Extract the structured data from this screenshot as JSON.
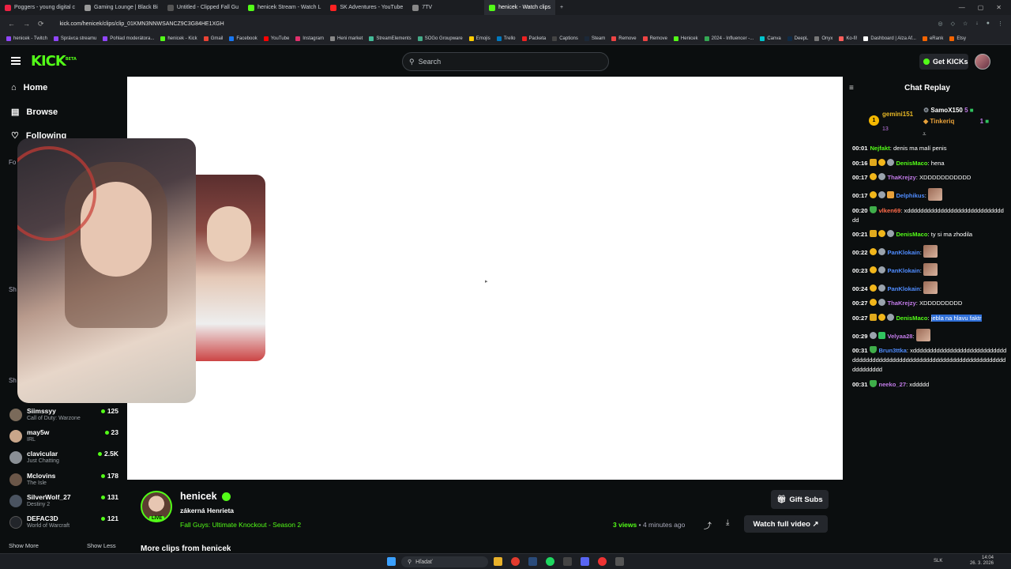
{
  "browser": {
    "tabs": [
      {
        "label": "Poggers - young digital c",
        "color": "#e24"
      },
      {
        "label": "Gaming Lounge | Black Bi",
        "color": "#999"
      },
      {
        "label": "Untitled - Clipped Fall Gu",
        "color": "#555"
      },
      {
        "label": "henicek Stream - Watch L",
        "color": "#53fc18"
      },
      {
        "label": "SK Adventures - YouTube",
        "color": "#f22"
      },
      {
        "label": "7TV",
        "color": "#888"
      },
      {
        "label": "henicek - Watch clips",
        "color": "#53fc18",
        "active": true
      }
    ],
    "url": "kick.com/henicek/clips/clip_01KMN3NNWSANCZ9C3G84HE1XGH",
    "bookmarks": [
      "henicek - Twitch",
      "Správca streamu",
      "Pohlad moderátora...",
      "henicek - Kick",
      "Gmail",
      "Facebook",
      "YouTube",
      "Instagram",
      "Heni market",
      "StreamElements",
      "SOGo Groupware",
      "Emojis",
      "Trello",
      "Packeta",
      "Captions",
      "Steam",
      "Remove",
      "Remove",
      "Henicek",
      "2024 - Influencer -...",
      "Canva",
      "DeepL",
      "Onyx",
      "Ko-fi!",
      "Dashboard | Alza Af...",
      "eRank",
      "Etsy"
    ]
  },
  "topnav": {
    "logo": "KICK",
    "logo_sup": "BETA",
    "search_placeholder": "Search",
    "get_kicks": "Get KICKs"
  },
  "sidebar": {
    "nav": [
      {
        "label": "Home",
        "icon": "home-icon"
      },
      {
        "label": "Browse",
        "icon": "browse-icon"
      },
      {
        "label": "Following",
        "icon": "heart-icon"
      }
    ],
    "partial_labels": {
      "fo": "Fo",
      "sh1": "Sh",
      "sh2": "Sh"
    },
    "channels": [
      {
        "name": "Siimssyy",
        "game": "Call of Duty: Warzone",
        "viewers": "125"
      },
      {
        "name": "may5w",
        "game": "IRL",
        "viewers": "23"
      },
      {
        "name": "clavicular",
        "game": "Just Chatting",
        "viewers": "2.5K"
      },
      {
        "name": "Mclovins",
        "game": "The Isle",
        "viewers": "178"
      },
      {
        "name": "SilverWolf_27",
        "game": "Destiny 2",
        "viewers": "131"
      },
      {
        "name": "DEFAC3D",
        "game": "World of Warcraft",
        "viewers": "121"
      }
    ],
    "show_more": "Show More",
    "show_less": "Show Less"
  },
  "chat": {
    "title": "Chat Replay",
    "top_gifters": [
      {
        "rank": "1",
        "name": "gemini151",
        "count": "13"
      },
      {
        "name": "SamoX150",
        "count": "5"
      },
      {
        "name": "Tinkeriq",
        "count": "1"
      }
    ],
    "messages": [
      {
        "ts": "00:01",
        "badges": [],
        "user": "Nejfakt",
        "color": "#53fc18",
        "text": "denis ma malí penis"
      },
      {
        "ts": "00:16",
        "badges": [
          "crown",
          "one",
          "gear"
        ],
        "user": "DenisMaco",
        "color": "#53fc18",
        "text": "hena"
      },
      {
        "ts": "00:17",
        "badges": [
          "one",
          "gear"
        ],
        "user": "ThaKrejzy",
        "color": "#c27be8",
        "text": "XDDDDDDDDDDD"
      },
      {
        "ts": "00:17",
        "badges": [
          "one",
          "gear",
          "gift"
        ],
        "user": "Delphikus",
        "color": "#4f8cff",
        "text": "",
        "emote": true
      },
      {
        "ts": "00:20",
        "badges": [
          "plant"
        ],
        "user": "vlken69",
        "color": "#ff6b4a",
        "text": "xddddddddddddddddddddddddddddddd"
      },
      {
        "ts": "00:21",
        "badges": [
          "crown",
          "one",
          "gear"
        ],
        "user": "DenisMaco",
        "color": "#53fc18",
        "text": "ty si ma zhodila"
      },
      {
        "ts": "00:22",
        "badges": [
          "one",
          "gear"
        ],
        "user": "PanKlokain",
        "color": "#4f8cff",
        "text": "",
        "emote": true
      },
      {
        "ts": "00:23",
        "badges": [
          "one",
          "gear"
        ],
        "user": "PanKlokain",
        "color": "#4f8cff",
        "text": "",
        "emote": true
      },
      {
        "ts": "00:24",
        "badges": [
          "one",
          "gear"
        ],
        "user": "PanKlokain",
        "color": "#4f8cff",
        "text": "",
        "emote": true
      },
      {
        "ts": "00:27",
        "badges": [
          "one",
          "gear"
        ],
        "user": "ThaKrejzy",
        "color": "#c27be8",
        "text": "XDDDDDDDDD"
      },
      {
        "ts": "00:27",
        "badges": [
          "crown",
          "one",
          "gear"
        ],
        "user": "DenisMaco",
        "color": "#53fc18",
        "text": "jebla na hlavu faktr",
        "highlight": true
      },
      {
        "ts": "00:29",
        "badges": [
          "gear",
          "grn"
        ],
        "user": "Velyaa28",
        "color": "#c27be8",
        "text": "",
        "emote": true
      },
      {
        "ts": "00:31",
        "badges": [
          "plant"
        ],
        "user": "Brun3ttka",
        "color": "#4f8cff",
        "text": "xddddddddddddddddddddddddddddddddddddddddddddddddddddddddddddddddddddddddddddddddddd"
      },
      {
        "ts": "00:31",
        "badges": [
          "plant"
        ],
        "user": "neeko_27",
        "color": "#c27be8",
        "text": "xddddd"
      }
    ]
  },
  "stream": {
    "name": "henicek",
    "live": "LIVE",
    "title": "zákerná Henrieta",
    "game": "Fall Guys: Ultimate Knockout - Season 2",
    "views_count": "3 views",
    "views_age": "• 4 minutes ago",
    "gift_subs": "Gift Subs",
    "watch_full": "Watch full video",
    "more_clips": "More clips from henicek"
  },
  "taskbar": {
    "search": "Hľadať",
    "lang": "SLK",
    "time": "14:04",
    "date": "26. 3. 2026"
  }
}
